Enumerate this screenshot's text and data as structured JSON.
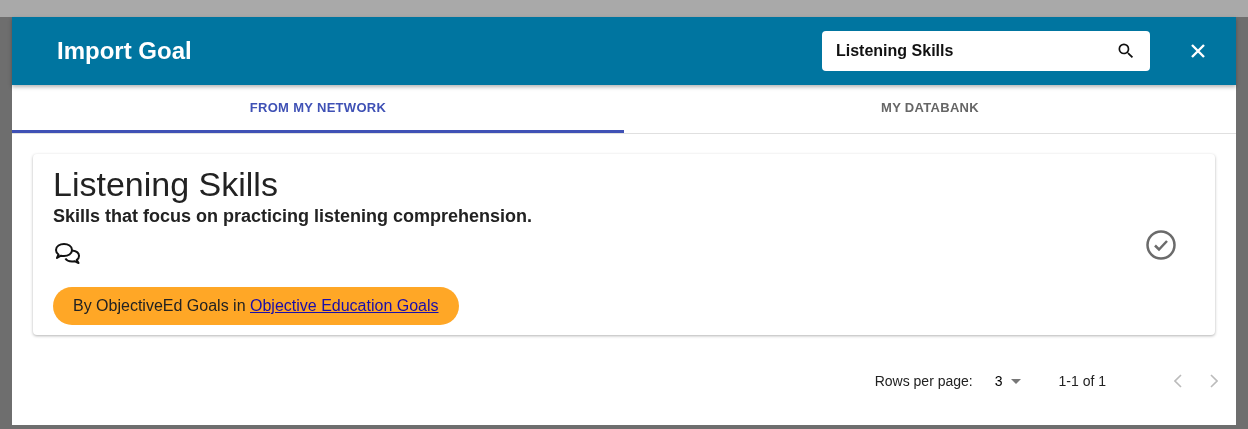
{
  "dialog": {
    "title": "Import Goal",
    "search": {
      "value": "Listening Skills"
    }
  },
  "tabs": [
    {
      "label": "FROM MY NETWORK",
      "selected": true
    },
    {
      "label": "MY DATABANK",
      "selected": false
    }
  ],
  "goals": [
    {
      "title": "Listening Skills",
      "description": "Skills that focus on practicing listening comprehension.",
      "source_prefix": "By ObjectiveEd Goals in",
      "source_link": "Objective Education Goals",
      "selected": false
    }
  ],
  "pagination": {
    "rows_label": "Rows per page:",
    "rows_value": "3",
    "range": "1-1 of 1"
  }
}
